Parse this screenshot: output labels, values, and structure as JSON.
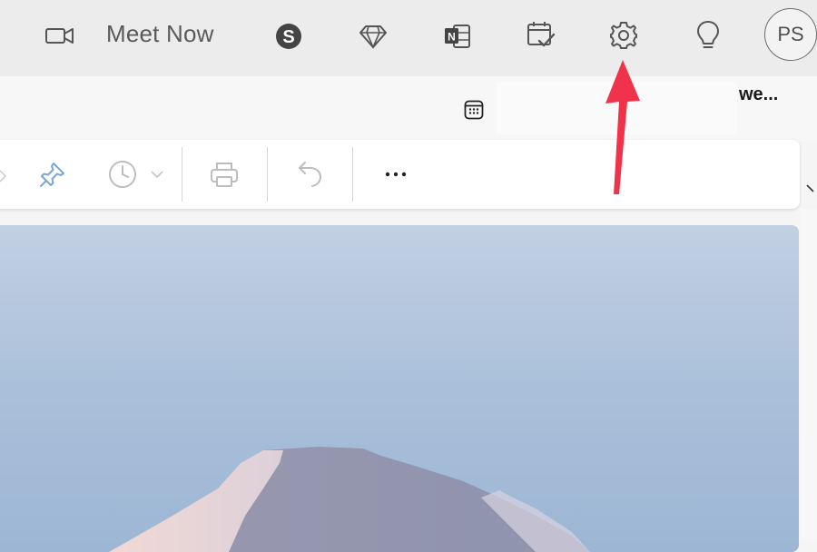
{
  "topbar": {
    "meet_icon": "video-camera-icon",
    "meet_label": "Meet Now",
    "icons": [
      "skype-icon",
      "diamond-premium-icon",
      "onenote-icon",
      "calendar-check-icon",
      "gear-icon",
      "lightbulb-icon"
    ],
    "avatar_initials": "PS"
  },
  "row2": {
    "calendar_icon": "calendar-grid-icon",
    "truncated_text": "we..."
  },
  "toolbar": {
    "icons": [
      "pin-icon",
      "clock-snooze-icon",
      "chevron-down-icon",
      "print-icon",
      "undo-icon",
      "more-icon"
    ]
  },
  "annotation": {
    "arrow": "red-arrow-icon",
    "color": "#f0334b"
  },
  "colors": {
    "topbar_bg": "#ececec",
    "toolbar_bg": "#ffffff",
    "accent_arrow": "#f0334b"
  }
}
